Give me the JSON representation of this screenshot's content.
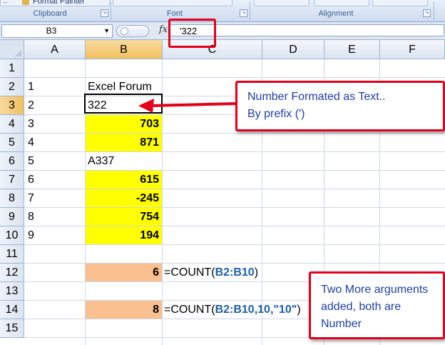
{
  "ribbon": {
    "format_painter_label": "Format Painter",
    "groups": [
      "Clipboard",
      "Font",
      "Alignment"
    ]
  },
  "formula_bar": {
    "name_box": "B3",
    "fx_symbol": "fx",
    "formula": "'322"
  },
  "columns": [
    "A",
    "B",
    "C",
    "D",
    "E",
    "F"
  ],
  "rows": [
    "1",
    "2",
    "3",
    "4",
    "5",
    "6",
    "7",
    "8",
    "9",
    "10",
    "11",
    "12",
    "13",
    "14",
    "15"
  ],
  "cells": {
    "A2": "1",
    "A3": "2",
    "A4": "3",
    "A5": "4",
    "A6": "5",
    "A7": "6",
    "A8": "7",
    "A9": "8",
    "A10": "9",
    "B2": "Excel Forum",
    "B3": "322",
    "B4": "703",
    "B5": "871",
    "B6": "A337",
    "B7": "615",
    "B8": "-245",
    "B9": "754",
    "B10": "194",
    "B12": "6",
    "B14": "8"
  },
  "formulas": {
    "C12": {
      "prefix": "=COUNT(",
      "ref": "B2:B10",
      "suffix": ")"
    },
    "C14": {
      "prefix": "=COUNT(",
      "ref": "B2:B10,10,\"10\"",
      "suffix": ")"
    }
  },
  "annotations": {
    "callout1_line1": "Number Formated as Text..",
    "callout1_line2": "By prefix (')",
    "callout2_line1": "Two More arguments",
    "callout2_line2": "added, both are",
    "callout2_line3": "Number"
  },
  "colors": {
    "yellow_fill": "#ffff00",
    "peach_fill": "#fac090",
    "annotation_red": "#e4001b",
    "annotation_text": "#1f3ea8",
    "ref_blue": "#1f5fa8"
  }
}
